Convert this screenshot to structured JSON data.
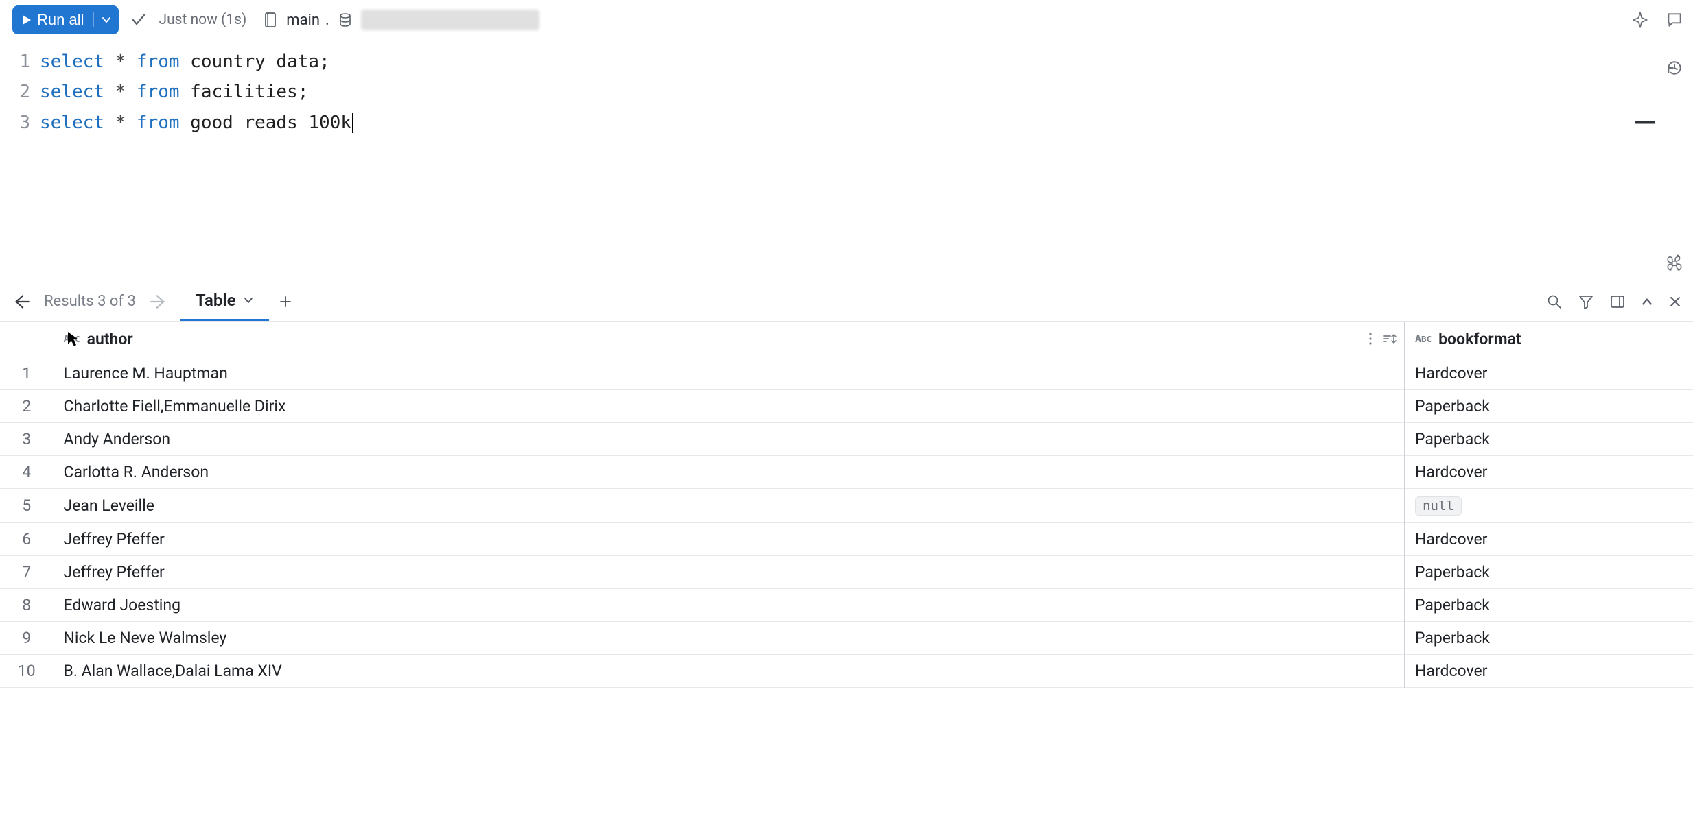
{
  "toolbar": {
    "run_label": "Run all",
    "status": "Just now (1s)",
    "catalog": "main",
    "schema_hidden": ""
  },
  "editor": {
    "lines": [
      {
        "num": "1",
        "kw1": "select",
        "op": "*",
        "kw2": "from",
        "ident": "country_data",
        "term": ";"
      },
      {
        "num": "2",
        "kw1": "select",
        "op": "*",
        "kw2": "from",
        "ident": "facilities",
        "term": ";"
      },
      {
        "num": "3",
        "kw1": "select",
        "op": "*",
        "kw2": "from",
        "ident": "good_reads_100k",
        "term": ""
      }
    ]
  },
  "results": {
    "counter": "Results 3 of 3",
    "tab_label": "Table"
  },
  "columns": {
    "author_label": "author",
    "bookformat_label": "bookformat",
    "type_badge": "ABC"
  },
  "rows": [
    {
      "n": "1",
      "author": "Laurence M. Hauptman",
      "bookformat": "Hardcover"
    },
    {
      "n": "2",
      "author": "Charlotte Fiell,Emmanuelle Dirix",
      "bookformat": "Paperback"
    },
    {
      "n": "3",
      "author": "Andy Anderson",
      "bookformat": "Paperback"
    },
    {
      "n": "4",
      "author": "Carlotta R. Anderson",
      "bookformat": "Hardcover"
    },
    {
      "n": "5",
      "author": "Jean Leveille",
      "bookformat": null
    },
    {
      "n": "6",
      "author": "Jeffrey Pfeffer",
      "bookformat": "Hardcover"
    },
    {
      "n": "7",
      "author": "Jeffrey Pfeffer",
      "bookformat": "Paperback"
    },
    {
      "n": "8",
      "author": "Edward Joesting",
      "bookformat": "Paperback"
    },
    {
      "n": "9",
      "author": "Nick Le Neve Walmsley",
      "bookformat": "Paperback"
    },
    {
      "n": "10",
      "author": "B. Alan Wallace,Dalai Lama XIV",
      "bookformat": "Hardcover"
    }
  ],
  "null_label": "null"
}
